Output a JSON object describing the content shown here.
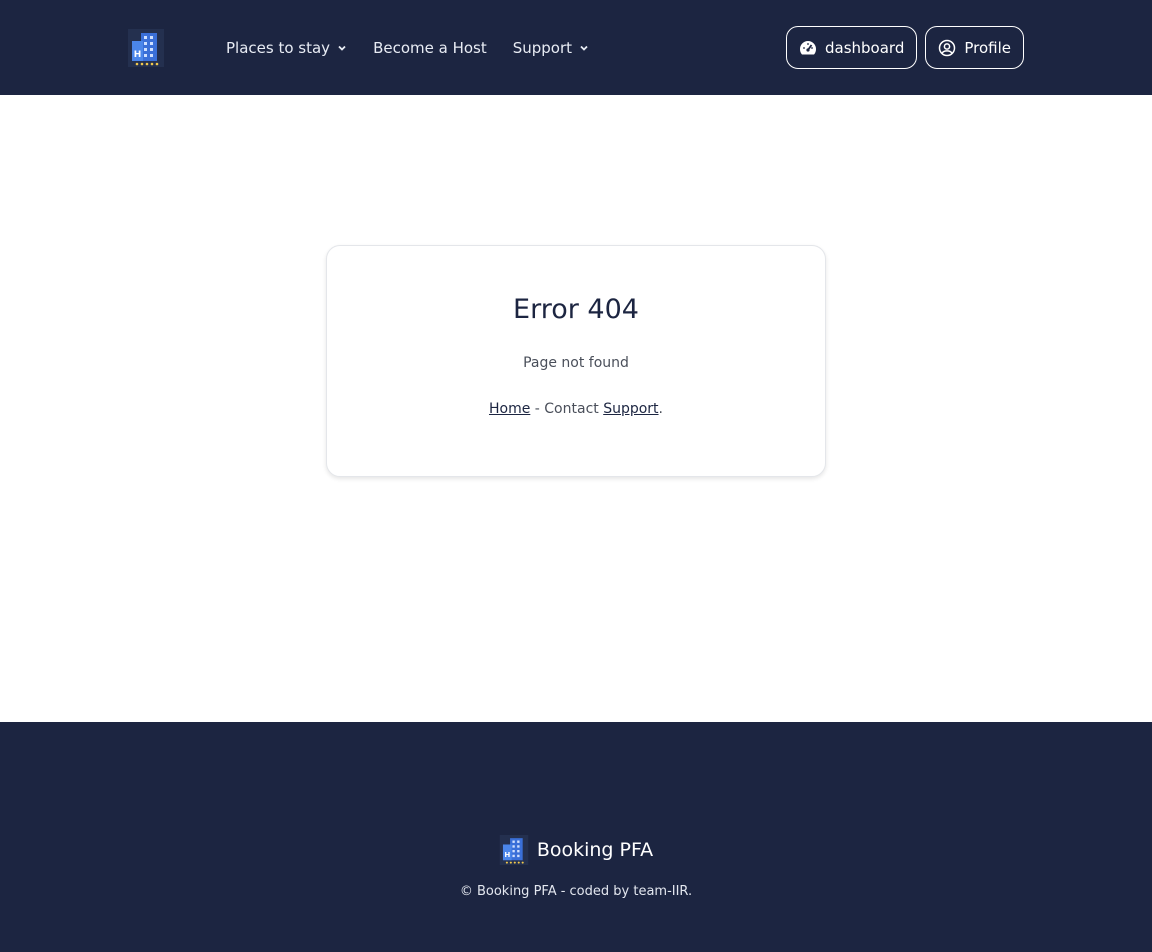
{
  "header": {
    "logo_icon": "hotel-building-icon",
    "nav": [
      {
        "label": "Places to stay",
        "has_dropdown": true
      },
      {
        "label": "Become a Host",
        "has_dropdown": false
      },
      {
        "label": "Support",
        "has_dropdown": true
      }
    ],
    "dashboard_label": "dashboard",
    "dashboard_icon": "speedometer-icon",
    "profile_label": "Profile",
    "profile_icon": "user-circle-icon"
  },
  "error": {
    "title": "Error 404",
    "message": "Page not found",
    "home_link": "Home",
    "separator": " - Contact ",
    "support_link": "Support",
    "end": "."
  },
  "footer": {
    "brand": "Booking PFA",
    "copyright": "© Booking PFA - coded by team-IIR."
  },
  "colors": {
    "navy": "#1c2541",
    "white": "#ffffff"
  }
}
